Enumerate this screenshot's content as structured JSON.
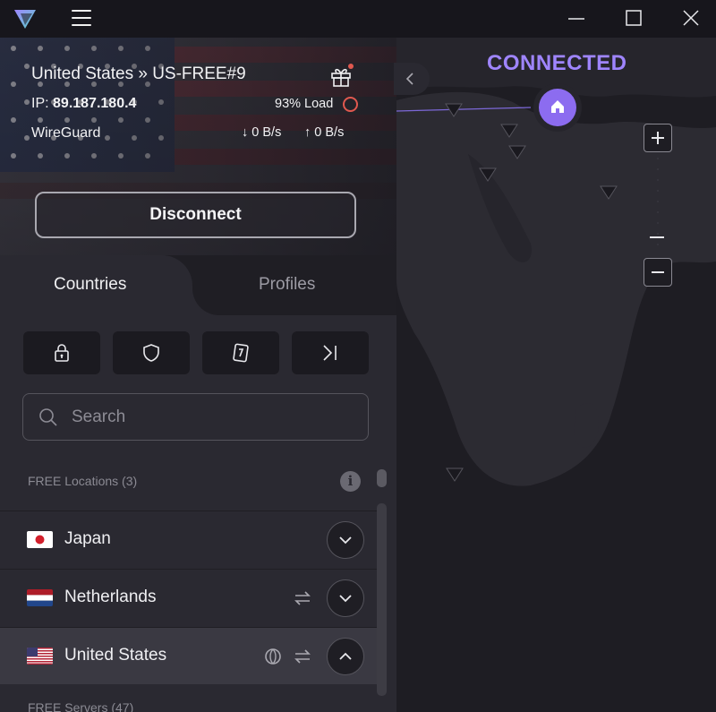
{
  "app": {
    "accent": "#8c6cf0",
    "status_color": "#9f85ff"
  },
  "titlebar": {
    "logo_icon": "protonvpn-logo-icon",
    "menu_icon": "hamburger-icon"
  },
  "connection": {
    "server": "United States » US-FREE#9",
    "ip_label": "IP:",
    "ip": "89.187.180.4",
    "protocol": "WireGuard",
    "load": "93% Load",
    "download": "0 B/s",
    "upload": "0 B/s",
    "disconnect_label": "Disconnect"
  },
  "tabs": [
    {
      "label": "Countries",
      "active": true
    },
    {
      "label": "Profiles",
      "active": false
    }
  ],
  "filters": [
    {
      "icon": "lock-icon"
    },
    {
      "icon": "shield-icon"
    },
    {
      "icon": "tor-onion-icon"
    },
    {
      "icon": "p2p-arrow-icon"
    }
  ],
  "search": {
    "placeholder": "Search",
    "value": ""
  },
  "locations": {
    "section_label": "FREE Locations (3)",
    "countries": [
      {
        "name": "Japan",
        "expanded": false
      },
      {
        "name": "Netherlands",
        "expanded": false
      },
      {
        "name": "United States",
        "expanded": true
      }
    ],
    "servers_label": "FREE Servers (47)"
  },
  "map": {
    "status": "CONNECTED"
  }
}
